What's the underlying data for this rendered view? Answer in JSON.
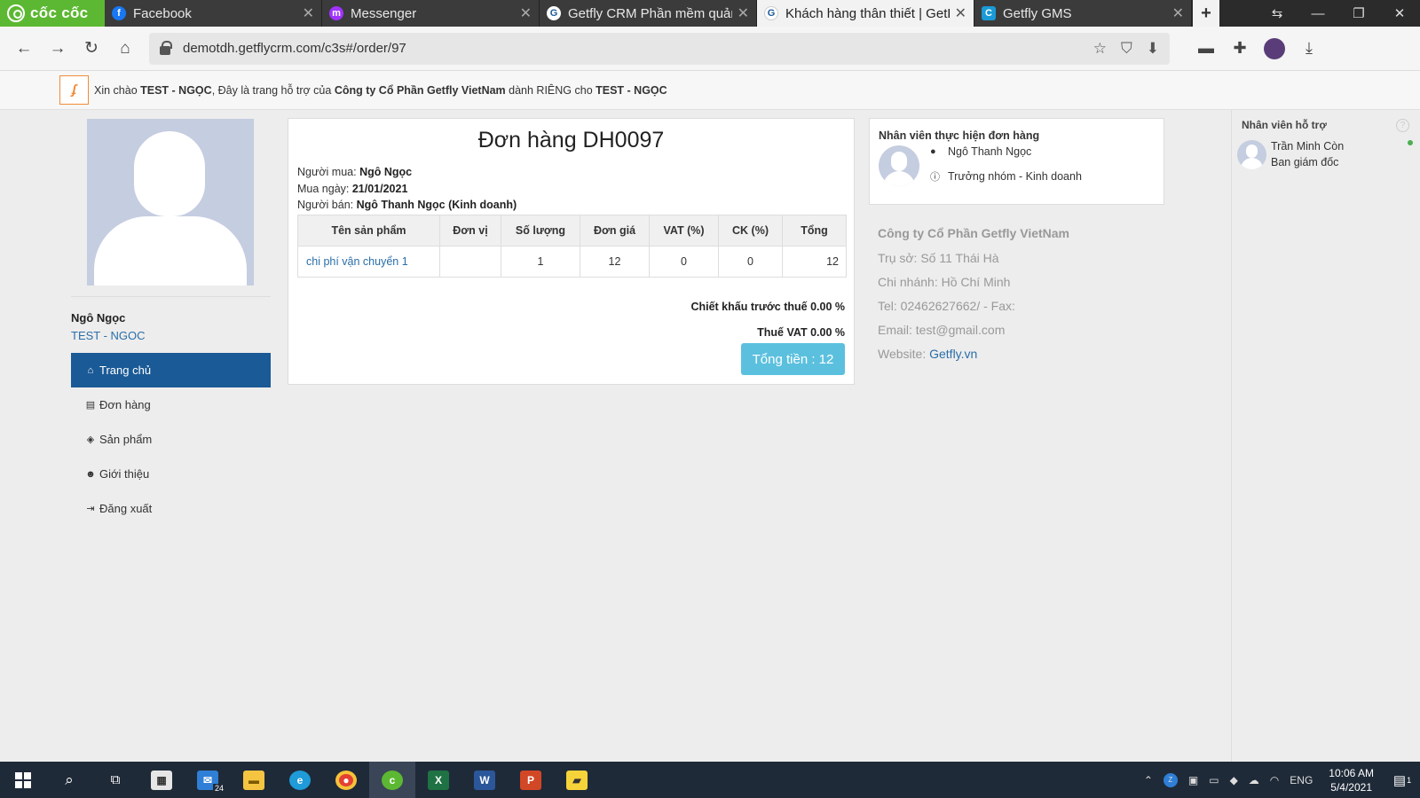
{
  "browser": {
    "brand": "cốc cốc",
    "tabs": [
      {
        "title": "Facebook",
        "color": "#1877f2",
        "glyph": "f"
      },
      {
        "title": "Messenger",
        "color": "#a033ff",
        "glyph": "m"
      },
      {
        "title": "Getfly CRM Phần mềm quản",
        "color": "#3b3b3b",
        "glyph": "G"
      },
      {
        "title": "Khách hàng thân thiết | GetFl",
        "color": "#f2f2f2",
        "glyph": "G"
      },
      {
        "title": "Getfly GMS",
        "color": "#1a9ad6",
        "glyph": "C"
      }
    ],
    "url": "demotdh.getflycrm.com/c3s#/order/97"
  },
  "greeting": {
    "prefix": "Xin chào ",
    "user": "TEST - NGỌC",
    "middle": ", Đây là trang hỗ trợ của ",
    "company": "Công ty Cổ Phần Getfly VietNam",
    "suffix": " dành RIÊNG cho ",
    "user2": "TEST - NGỌC"
  },
  "profile": {
    "name": "Ngô Ngọc",
    "code": "TEST - NGOC"
  },
  "menu": [
    {
      "label": "Trang chủ",
      "icon": "home-icon",
      "glyph": "⌂"
    },
    {
      "label": "Đơn hàng",
      "icon": "file-icon",
      "glyph": "▤"
    },
    {
      "label": "Sản phẩm",
      "icon": "cube-icon",
      "glyph": "◈"
    },
    {
      "label": "Giới thiệu",
      "icon": "users-icon",
      "glyph": "☻"
    },
    {
      "label": "Đăng xuất",
      "icon": "sign-out-icon",
      "glyph": "⇥"
    }
  ],
  "order": {
    "title": "Đơn hàng DH0097",
    "buyer_label": "Người mua: ",
    "buyer": "Ngô Ngọc",
    "date_label": "Mua ngày: ",
    "date": "21/01/2021",
    "seller_label": "Người bán: ",
    "seller": "Ngô Thanh Ngọc (Kinh doanh)",
    "columns": [
      "Tên sản phẩm",
      "Đơn vị",
      "Số lượng",
      "Đơn giá",
      "VAT (%)",
      "CK (%)",
      "Tổng"
    ],
    "rows": [
      {
        "name": "chi phí vận chuyển 1",
        "unit": "",
        "qty": "1",
        "price": "12",
        "vat": "0",
        "ck": "0",
        "total": "12"
      }
    ],
    "discount_text": "Chiết khấu trước thuế 0.00 %",
    "vat_text": "Thuế VAT 0.00 %",
    "total_label": "Tổng tiền : 12"
  },
  "staff": {
    "title": "Nhân viên thực hiện đơn hàng",
    "name": "Ngô Thanh Ngọc",
    "role": "Trưởng nhóm - Kinh doanh"
  },
  "company": {
    "name": "Công ty Cổ Phần Getfly VietNam",
    "hq": "Trụ sở: Số 11 Thái Hà",
    "branch": "Chi nhánh: Hồ Chí Minh",
    "tel": "Tel: 02462627662/ - Fax:",
    "email": "Email: test@gmail.com",
    "website_label": "Website: ",
    "website": "Getfly.vn"
  },
  "support": {
    "title": "Nhân viên hỗ trợ",
    "name": "Trần Minh Còn",
    "role": "Ban giám đốc"
  },
  "taskbar": {
    "mail_badge": "24",
    "lang": "ENG",
    "time": "10:06 AM",
    "date": "5/4/2021",
    "notif_count": "1"
  }
}
